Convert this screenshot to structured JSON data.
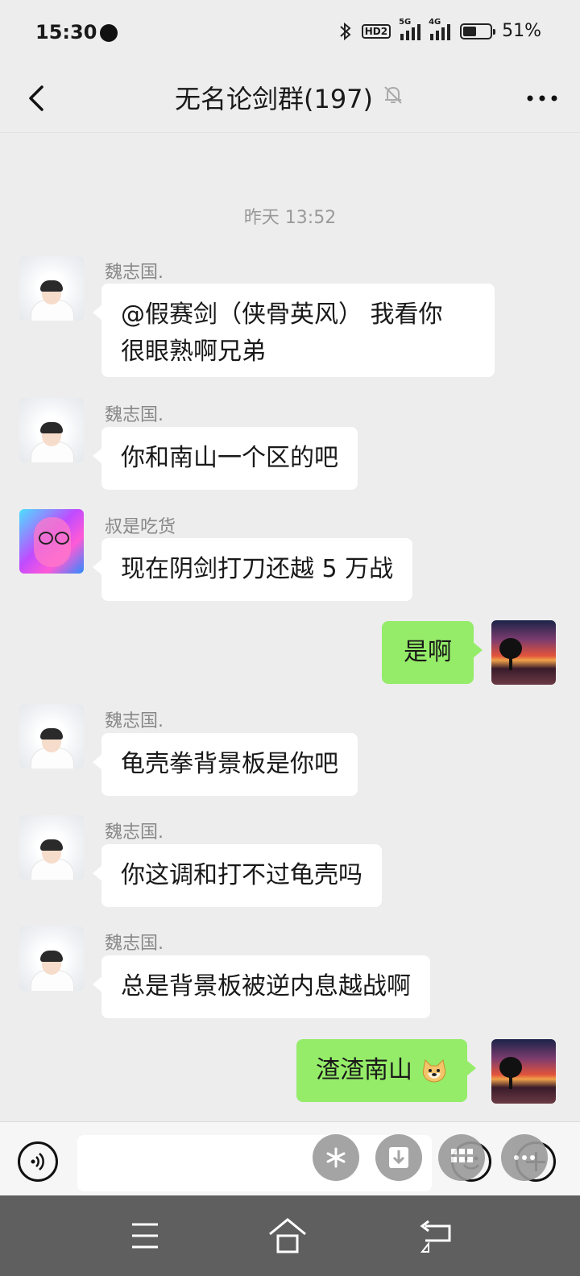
{
  "status": {
    "time": "15:30",
    "hd": "HD2",
    "net1": "5G",
    "net2": "4G",
    "battery": "51%",
    "battery_level": 0.51
  },
  "nav": {
    "title": "无名论剑群(197)"
  },
  "timestamp": "昨天 13:52",
  "messages": [
    {
      "sender": "魏志国.",
      "text1": "@假赛剑（侠骨英风） 我看你",
      "text2": "很眼熟啊兄弟"
    },
    {
      "sender": "魏志国.",
      "text": "你和南山一个区的吧"
    },
    {
      "sender": "叔是吃货",
      "text": "现在阴剑打刀还越 5 万战"
    },
    {
      "sender": "me",
      "text": "是啊"
    },
    {
      "sender": "魏志国.",
      "text": "龟壳拳背景板是你吧"
    },
    {
      "sender": "魏志国.",
      "text": "你这调和打不过龟壳吗"
    },
    {
      "sender": "魏志国.",
      "text": "总是背景板被逆内息越战啊"
    },
    {
      "sender": "me",
      "text": "渣渣南山"
    }
  ],
  "icons": {
    "back": "back-arrow-icon",
    "mute": "bell-muted-icon",
    "more": "more-dots-icon",
    "voice": "voice-icon",
    "emoji": "emoji-icon",
    "plus": "plus-icon",
    "menu": "menu-icon",
    "home": "home-icon",
    "return": "back-icon"
  },
  "colors": {
    "my_bubble": "#95ec69",
    "other_bubble": "#ffffff",
    "background": "#ededed"
  }
}
